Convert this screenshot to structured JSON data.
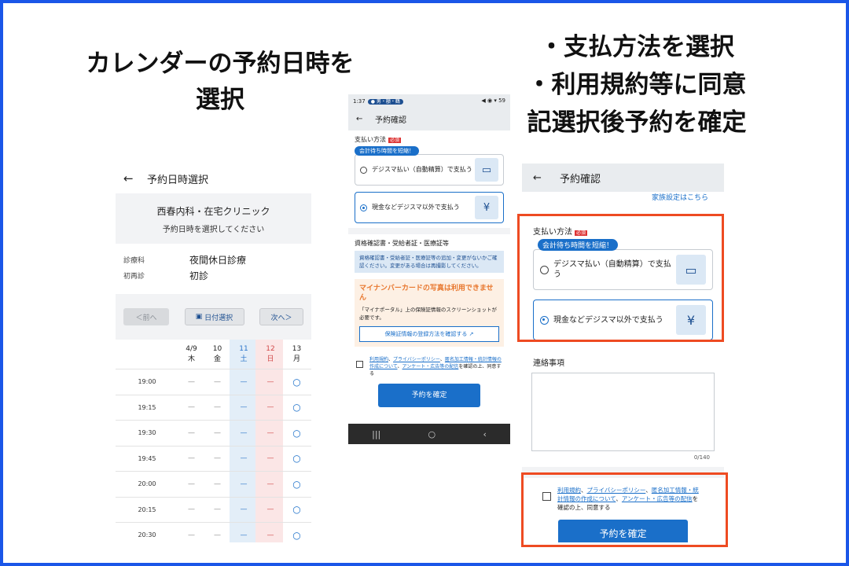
{
  "captions": {
    "left_line1": "カレンダーの予約日時を",
    "left_line2": "選択",
    "right_line1": "・支払方法を選択",
    "right_line2": "・利用規約等に同意",
    "right_line3": "記選択後予約を確定"
  },
  "calendar": {
    "title": "予約日時選択",
    "clinic_name": "西春内科・在宅クリニック",
    "clinic_sub": "予約日時を選択してください",
    "dept_label": "診療科",
    "dept_value": "夜間休日診療",
    "visit_label": "初再診",
    "visit_value": "初診",
    "prev": "＜前へ",
    "pick_date": "日付選択",
    "next": "次へ＞",
    "days": [
      {
        "date": "4/9",
        "dow": "木"
      },
      {
        "date": "10",
        "dow": "金"
      },
      {
        "date": "11",
        "dow": "土"
      },
      {
        "date": "12",
        "dow": "日"
      },
      {
        "date": "13",
        "dow": "月"
      }
    ],
    "times": [
      "19:00",
      "19:15",
      "19:30",
      "19:45",
      "20:00",
      "20:15",
      "20:30"
    ],
    "dash": "—",
    "ok": "○"
  },
  "mid": {
    "status_time": "1:37",
    "status_pill": "● 男・額・鶴",
    "status_right": "◀︎ ◉ ▾ 59",
    "title": "予約確認",
    "pay_label": "支払い方法",
    "required": "必須",
    "badge": "会計待ち時間を短縮！",
    "opt1": "デジスマ払い（自動精算）で支払う",
    "opt2": "現金などデジスマ以外で支払う",
    "doc_head": "資格確認書・受給者証・医療証等",
    "doc_info": "資格確認書・受給者証・医療証等の追加・変更がないかご確認ください。変更がある場合は再撮影してください。",
    "warn_title": "マイナンバーカードの写真は利用できません",
    "warn_desc": "「マイナポータル」上の保険証情報のスクリーンショットが必要です。",
    "warn_btn": "保険証情報の登録方法を確認する",
    "agree_l1": "利用規約",
    "agree_l2": "プライバシーポリシー",
    "agree_l3": "匿名加工情報・統計情報の作成について",
    "agree_l4": "アンケート・広告等の配信",
    "agree_tail": "を確認の上、同意する",
    "confirm": "予約を確定"
  },
  "right": {
    "title": "予約確認",
    "family": "家族設定はこちら",
    "pay_label": "支払い方法",
    "required": "必須",
    "badge": "会計待ち時間を短縮！",
    "opt1": "デジスマ払い（自動精算）で支払う",
    "opt2": "現金などデジスマ以外で支払う",
    "contact": "連絡事項",
    "counter": "0/140",
    "agree_l1": "利用規約",
    "agree_l2": "プライバシーポリシー",
    "agree_l3": "匿名加工情報・統計情報の作成について",
    "agree_l4": "アンケート・広告等の配信",
    "agree_tail": "を確認の上、同意する",
    "confirm": "予約を確定"
  },
  "colors": {
    "accent": "#1a6fc9",
    "highlight": "#ee4b22",
    "frame": "#1a56e8"
  }
}
